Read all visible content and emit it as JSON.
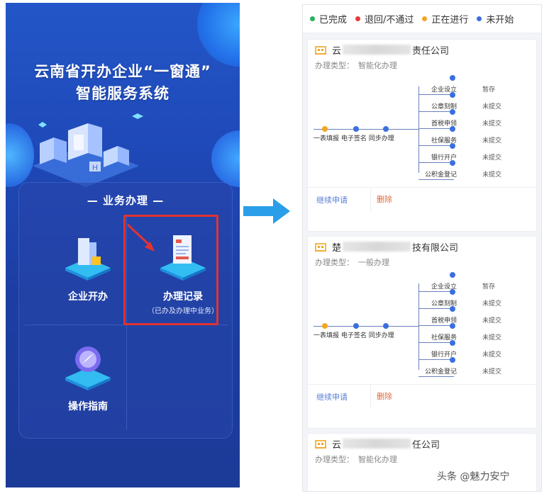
{
  "left": {
    "title_line1": "云南省开办企业“一窗通”",
    "title_line2": "智能服务系统",
    "card_title": "— 业务办理 —",
    "tiles": [
      {
        "label": "企业开办",
        "sub": ""
      },
      {
        "label": "办理记录",
        "sub": "（已办及办理中业务）"
      },
      {
        "label": "操作指南",
        "sub": ""
      }
    ]
  },
  "legend": [
    {
      "label": "已完成",
      "color": "#27b35a"
    },
    {
      "label": "退回/不通过",
      "color": "#e43b3b"
    },
    {
      "label": "正在进行",
      "color": "#f2a623"
    },
    {
      "label": "未开始",
      "color": "#3a6fe0"
    }
  ],
  "records": [
    {
      "company_prefix": "云",
      "company_suffix": "责任公司",
      "type_label": "办理类型：",
      "type_value": "智能化办理",
      "main_label": "一表填报 电子签名 同步办理",
      "branches": [
        {
          "label": "企业设立",
          "status": "暂存"
        },
        {
          "label": "公章刻制",
          "status": "未提交"
        },
        {
          "label": "首税申领",
          "status": "未提交"
        },
        {
          "label": "社保服务",
          "status": "未提交"
        },
        {
          "label": "银行开户",
          "status": "未提交"
        },
        {
          "label": "公积金登记",
          "status": "未提交"
        }
      ],
      "action_continue": "继续申请",
      "action_delete": "删除"
    },
    {
      "company_prefix": "楚",
      "company_suffix": "技有限公司",
      "type_label": "办理类型：",
      "type_value": "一般办理",
      "main_label": "一表填报 电子签名 同步办理",
      "branches": [
        {
          "label": "企业设立",
          "status": "暂存"
        },
        {
          "label": "公章刻制",
          "status": "未提交"
        },
        {
          "label": "首税申领",
          "status": "未提交"
        },
        {
          "label": "社保服务",
          "status": "未提交"
        },
        {
          "label": "银行开户",
          "status": "未提交"
        },
        {
          "label": "公积金登记",
          "status": "未提交"
        }
      ],
      "action_continue": "继续申请",
      "action_delete": "删除"
    },
    {
      "company_prefix": "云",
      "company_suffix": "任公司",
      "type_label": "办理类型：",
      "type_value": "智能化办理"
    }
  ],
  "watermark": "头条 @魅力安宁"
}
